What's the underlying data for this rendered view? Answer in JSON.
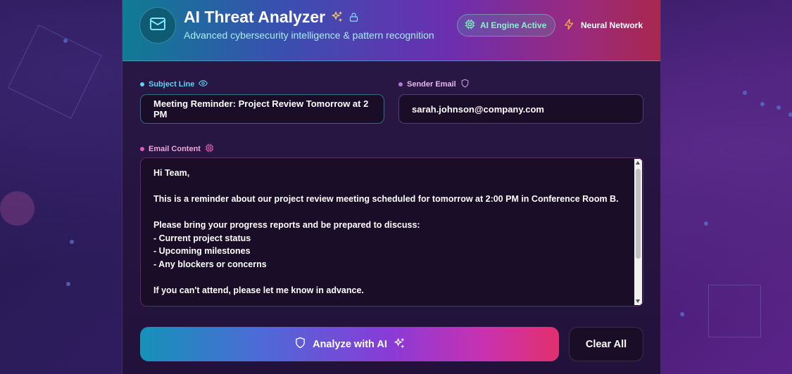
{
  "colors": {
    "accent_cyan": "#5fd3f3",
    "accent_pink": "#e05bb5",
    "accent_green": "#8ef0c8",
    "brand_gradient_start": "#0e7c93",
    "brand_gradient_end": "#a8284e"
  },
  "header": {
    "title": "AI Threat Analyzer",
    "subtitle": "Advanced cybersecurity intelligence & pattern recognition",
    "logo_icon": "mail-icon",
    "engine_badge": "AI Engine Active",
    "neural_label": "Neural Network"
  },
  "form": {
    "subject": {
      "label": "Subject Line",
      "value": "Meeting Reminder: Project Review Tomorrow at 2 PM"
    },
    "sender": {
      "label": "Sender Email",
      "value": "sarah.johnson@company.com"
    },
    "content": {
      "label": "Email Content",
      "value": "Hi Team,\n\nThis is a reminder about our project review meeting scheduled for tomorrow at 2:00 PM in Conference Room B.\n\nPlease bring your progress reports and be prepared to discuss:\n- Current project status\n- Upcoming milestones\n- Any blockers or concerns\n\nIf you can't attend, please let me know in advance."
    }
  },
  "actions": {
    "analyze_label": "Analyze with AI",
    "clear_label": "Clear All"
  }
}
